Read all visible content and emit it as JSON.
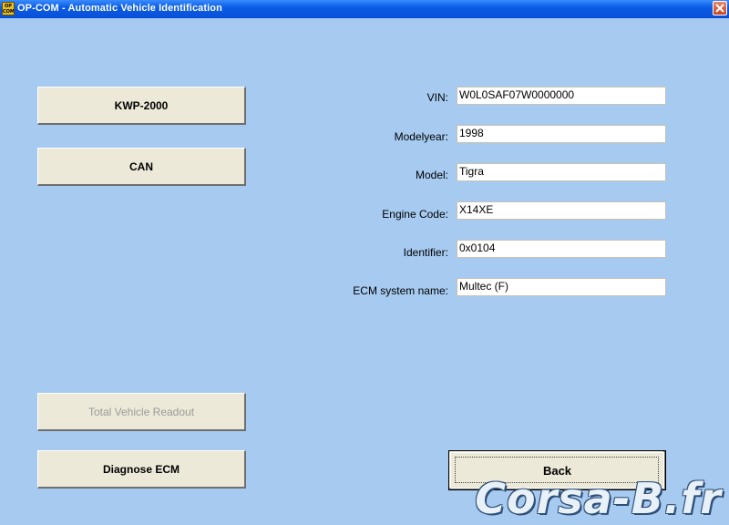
{
  "window": {
    "title": "OP-COM - Automatic Vehicle Identification",
    "icon_text": "OP COM"
  },
  "buttons": {
    "kwp2000": "KWP-2000",
    "can": "CAN",
    "total_readout": "Total Vehicle Readout",
    "diagnose_ecm": "Diagnose ECM",
    "back": "Back"
  },
  "fields": [
    {
      "label": "VIN:",
      "value": "W0L0SAF07W0000000"
    },
    {
      "label": "Modelyear:",
      "value": "1998"
    },
    {
      "label": "Model:",
      "value": "Tigra"
    },
    {
      "label": "Engine Code:",
      "value": "X14XE"
    },
    {
      "label": "Identifier:",
      "value": "0x0104"
    },
    {
      "label": "ECM system name:",
      "value": "Multec (F)"
    }
  ],
  "watermark": "Corsa-B.fr",
  "colors": {
    "background": "#a6caf0",
    "titlebar": "#0a5ce6",
    "button_face": "#ece9d8",
    "disabled_text": "#9a9a9a"
  }
}
